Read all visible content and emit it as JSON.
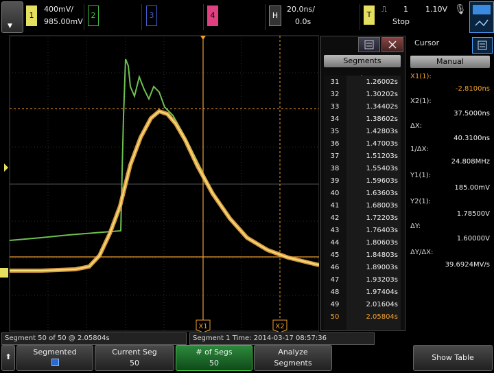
{
  "top": {
    "ch1_label": "1",
    "ch1_scale": "400mV/",
    "ch1_offset": "985.00mV",
    "ch2_label": "2",
    "ch3_label": "3",
    "ch4_label": "4",
    "h_label": "H",
    "timebase": "20.0ns/",
    "delay": "0.0s",
    "t_label": "T",
    "trigger_source": "1",
    "trigger_level": "1.10V",
    "run_state": "Stop"
  },
  "segments": {
    "title": "Segments",
    "rows": [
      {
        "n": "31",
        "t": "1.26002s"
      },
      {
        "n": "32",
        "t": "1.30202s"
      },
      {
        "n": "33",
        "t": "1.34402s"
      },
      {
        "n": "34",
        "t": "1.38602s"
      },
      {
        "n": "35",
        "t": "1.42803s"
      },
      {
        "n": "36",
        "t": "1.47003s"
      },
      {
        "n": "37",
        "t": "1.51203s"
      },
      {
        "n": "38",
        "t": "1.55403s"
      },
      {
        "n": "39",
        "t": "1.59603s"
      },
      {
        "n": "40",
        "t": "1.63603s"
      },
      {
        "n": "41",
        "t": "1.68003s"
      },
      {
        "n": "42",
        "t": "1.72203s"
      },
      {
        "n": "43",
        "t": "1.76403s"
      },
      {
        "n": "44",
        "t": "1.80603s"
      },
      {
        "n": "45",
        "t": "1.84803s"
      },
      {
        "n": "46",
        "t": "1.89003s"
      },
      {
        "n": "47",
        "t": "1.93203s"
      },
      {
        "n": "48",
        "t": "1.97404s"
      },
      {
        "n": "49",
        "t": "2.01604s"
      },
      {
        "n": "50",
        "t": "2.05804s"
      }
    ]
  },
  "cursor": {
    "title": "Cursor",
    "mode": "Manual",
    "x1_label": "X1(1):",
    "x1_value": "-2.8100ns",
    "x2_label": "X2(1):",
    "x2_value": "37.5000ns",
    "dx_label": "ΔX:",
    "dx_value": "40.3100ns",
    "inv_dx_label": "1/ΔX:",
    "inv_dx_value": "24.808MHz",
    "y1_label": "Y1(1):",
    "y1_value": "185.00mV",
    "y2_label": "Y2(1):",
    "y2_value": "1.78500V",
    "dy_label": "ΔY:",
    "dy_value": "1.60000V",
    "dydx_label": "ΔY/ΔX:",
    "dydx_value": "39.6924MV/s"
  },
  "markers": {
    "x1": "X1",
    "x2": "X2"
  },
  "status": {
    "left": "Segment 50 of 50 @ 2.05804s",
    "right": "Segment 1 Time: 2014-03-17 08:57:36"
  },
  "softkeys": {
    "segmented": "Segmented",
    "current_seg_label": "Current Seg",
    "current_seg_value": "50",
    "num_segs_label": "# of Segs",
    "num_segs_value": "50",
    "analyze_l1": "Analyze",
    "analyze_l2": "Segments",
    "show_table": "Show Table"
  },
  "colors": {
    "ch1": "#e6e060",
    "ch2": "#40c040",
    "cursor": "#f0a030"
  }
}
